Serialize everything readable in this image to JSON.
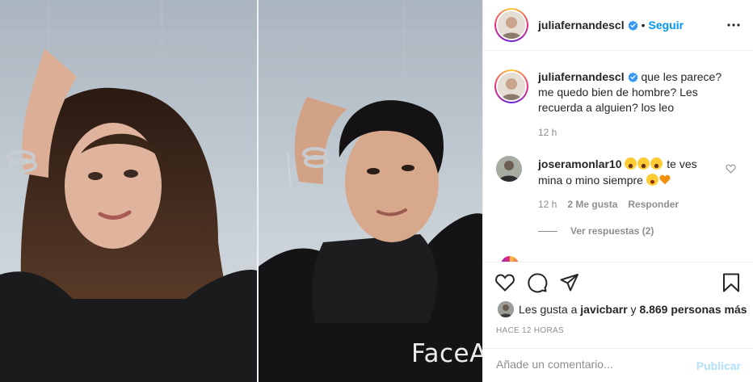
{
  "media": {
    "watermark": "FaceA"
  },
  "header": {
    "username": "juliafernandescl",
    "separator": "•",
    "follow_label": "Seguir"
  },
  "caption": {
    "username": "juliafernandescl",
    "text": "que les parece? me quedo bien de hombre? Les recuerda a alguien? los leo",
    "time": "12 h"
  },
  "comment": {
    "username": "joseramonlar10",
    "text_a": "te ves mina o mino siempre",
    "time": "12 h",
    "likes": "2 Me gusta",
    "reply_label": "Responder",
    "view_replies": "Ver respuestas (2)"
  },
  "likes": {
    "prefix": "Les gusta a ",
    "user": "javicbarr",
    "middle": " y ",
    "count": "8.869 personas más"
  },
  "time_ago": "HACE 12 HORAS",
  "add_comment": {
    "placeholder": "Añade un comentario...",
    "publish_label": "Publicar"
  },
  "colors": {
    "accent": "#0095f6",
    "publish_disabled": "#b2dffc",
    "muted": "#8e8e8e"
  },
  "icons": [
    "verified-badge-icon",
    "more-options-icon",
    "heart-icon",
    "comment-icon",
    "share-icon",
    "bookmark-icon"
  ]
}
